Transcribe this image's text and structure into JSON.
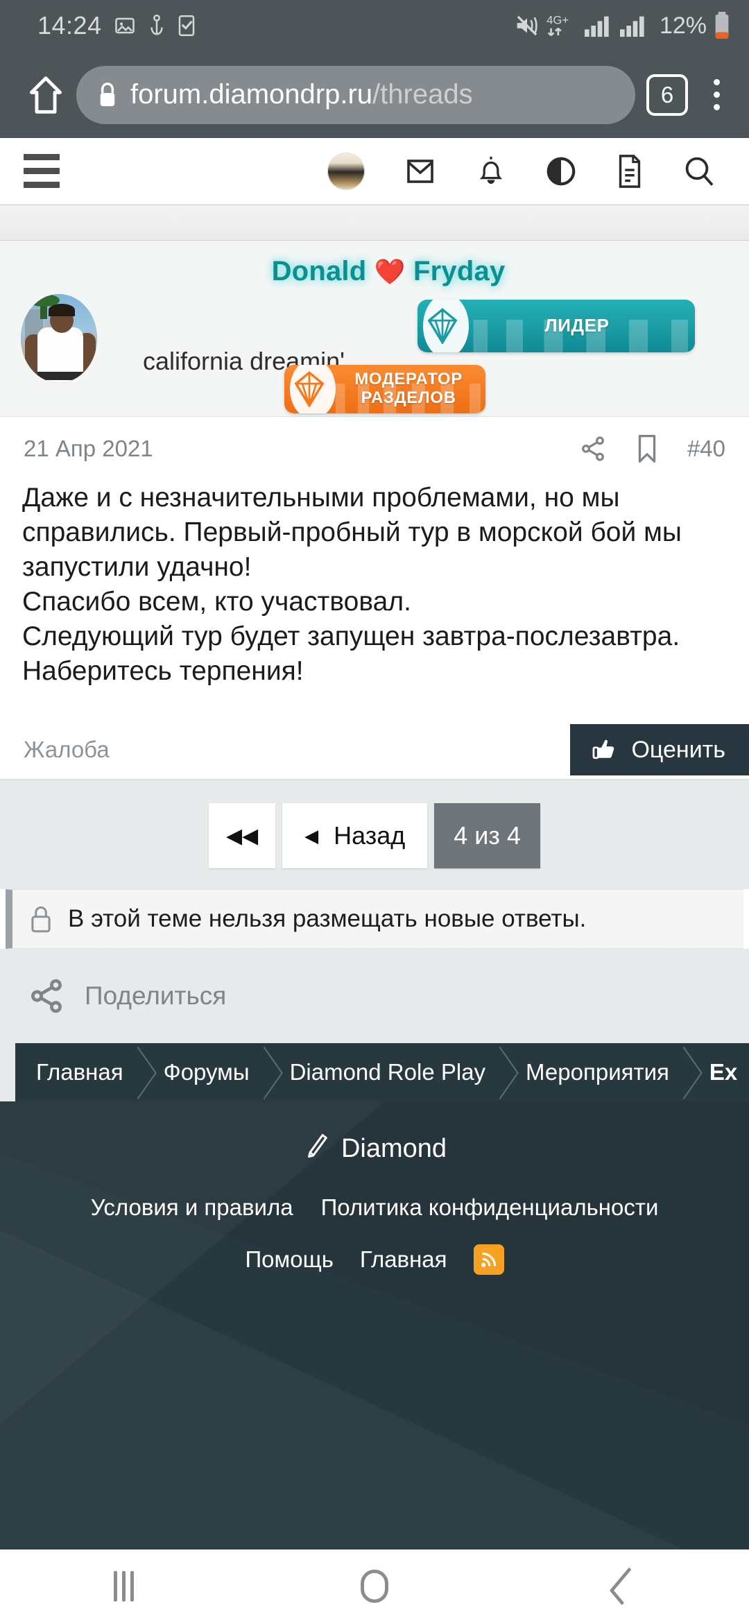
{
  "status_bar": {
    "clock": "14:24",
    "network": "4G+",
    "battery_percent": "12%",
    "icons": [
      "image-icon",
      "anchor-icon",
      "checkbox-icon",
      "mute-icon",
      "data-transfer-icon",
      "signal-bars-icon",
      "signal-bars-icon",
      "battery-icon"
    ]
  },
  "browser": {
    "url_host": "forum.diamondrp.ru",
    "url_path": "/threads",
    "tab_count": "6",
    "icons": [
      "home-icon",
      "lock-icon",
      "tab-counter-icon",
      "more-vertical-icon"
    ]
  },
  "forum_nav": {
    "icons": [
      "hamburger-menu-icon",
      "user-avatar",
      "inbox-icon",
      "bell-icon",
      "dark-mode-toggle-icon",
      "page-icon",
      "search-icon"
    ]
  },
  "post": {
    "username": "Donald",
    "username_heart": "❤️",
    "username_suffix": "Fryday",
    "user_title": "california dreamin'",
    "badges": [
      {
        "label": "ЛИДЕР",
        "color": "#1b9ca4",
        "icon": "diamond-icon"
      },
      {
        "label_line1": "МОДЕРАТОР",
        "label_line2": "РАЗДЕЛОВ",
        "color": "#f4791f",
        "icon": "diamond-icon"
      }
    ],
    "date": "21 Апр 2021",
    "post_number": "#40",
    "meta_icons": [
      "share-icon",
      "bookmark-icon"
    ],
    "paragraphs": [
      "Даже и с незначительными проблемами, но мы справились. Первый-пробный тур в морской бой мы запустили удачно!",
      "Спасибо всем, кто участвовал.",
      "Следующий тур будет запущен завтра-послезавтра. Наберитесь терпения!"
    ],
    "report_label": "Жалоба",
    "rate_label": "Оценить",
    "rate_icon": "thumbs-up-icon"
  },
  "pagination": {
    "first_label": "◀◀",
    "prev_caret": "◀",
    "prev_label": "Назад",
    "current_label": "4 из 4",
    "current_page": 4,
    "total_pages": 4
  },
  "locked_notice": {
    "text": "В этой теме нельзя размещать новые ответы.",
    "icon": "lock-icon"
  },
  "share": {
    "label": "Поделиться",
    "icon": "share-icon"
  },
  "breadcrumbs": [
    {
      "label": "Главная"
    },
    {
      "label": "Форумы"
    },
    {
      "label": "Diamond Role Play"
    },
    {
      "label": "Мероприятия"
    },
    {
      "label": "Ex"
    }
  ],
  "footer": {
    "brand": "Diamond",
    "brand_icon": "brush-icon",
    "links_row1": [
      "Условия и правила",
      "Политика конфиденциальности"
    ],
    "links_row2": [
      "Помощь",
      "Главная"
    ],
    "rss_icon": "rss-icon"
  },
  "android_nav": {
    "items": [
      "recents-icon",
      "home-icon",
      "back-icon"
    ]
  },
  "colors": {
    "status_bar_bg": "#4e5559",
    "accent_teal": "#1b9ca4",
    "accent_orange": "#f4791f",
    "footer_bg": "#27383f",
    "rate_btn_bg": "#28363f",
    "pager_active_bg": "#6d757b",
    "rss_orange": "#f7a122"
  }
}
